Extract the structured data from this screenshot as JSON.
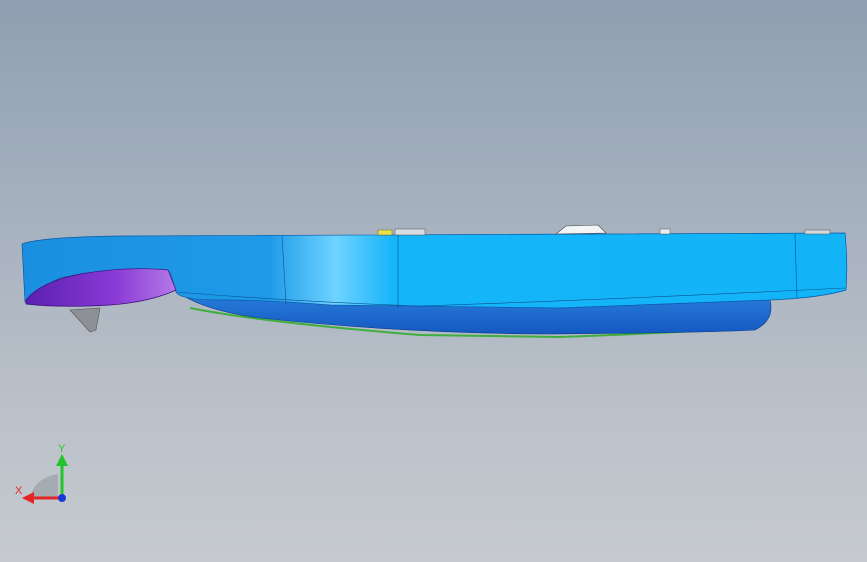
{
  "viewport": {
    "background_top": "#8f9fb1",
    "background_bottom": "#c6cacf"
  },
  "model": {
    "body_color": "#19b3f5",
    "body_dark_color": "#1f88d6",
    "lower_hull_color": "#1c74d9",
    "purple_color": "#7a2fc8",
    "green_edge_color": "#3fae3f",
    "fin_color": "#8b8f94",
    "yellow_part_color": "#e8e04a",
    "white_part_color": "#f2f4f6"
  },
  "triad": {
    "x_label": "X",
    "y_label": "Y",
    "x_color": "#e32626",
    "y_color": "#22c42e",
    "z_color": "#1b36d8"
  }
}
